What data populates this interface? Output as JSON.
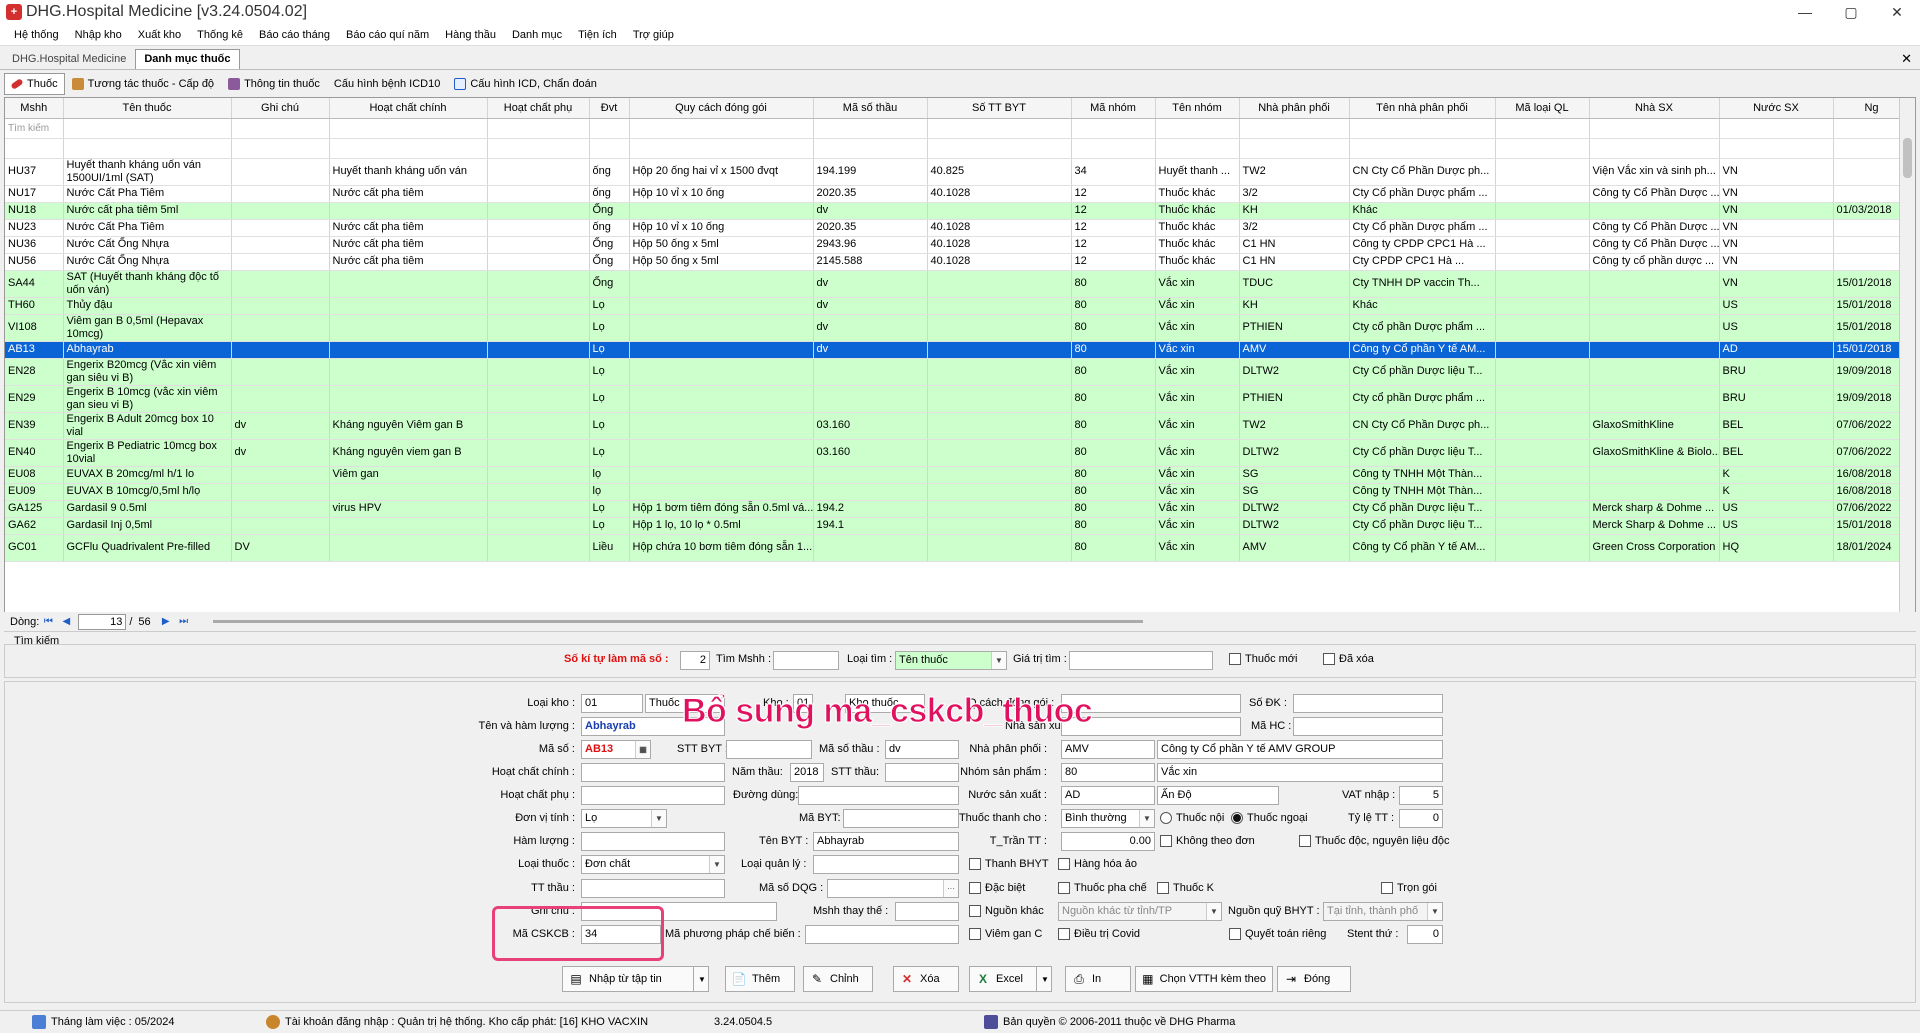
{
  "window": {
    "title": "DHG.Hospital Medicine [v3.24.0504.02]",
    "min": "—",
    "max": "▢",
    "close": "✕"
  },
  "menu": [
    "Hệ thống",
    "Nhập kho",
    "Xuất kho",
    "Thống kê",
    "Báo cáo tháng",
    "Báo cáo quí năm",
    "Hàng thầu",
    "Danh mục",
    "Tiện ích",
    "Trợ giúp"
  ],
  "doc_tabs": [
    "DHG.Hospital Medicine",
    "Danh mục thuốc"
  ],
  "sub_tabs": [
    "Thuốc",
    "Tương tác thuốc - Cấp độ",
    "Thông tin thuốc",
    "Cấu hình bệnh ICD10",
    "Cấu hình ICD, Chẩn đoán"
  ],
  "grid": {
    "columns": [
      "Mshh",
      "Tên thuốc",
      "Ghi chú",
      "Hoạt chất chính",
      "Hoạt chất phụ",
      "Đvt",
      "Quy cách đóng gói",
      "Mã số thầu",
      "Số TT BYT",
      "Mã nhóm",
      "Tên nhóm",
      "Nhà phân phối",
      "Tên nhà phân phối",
      "Mã loại QL",
      "Nhà SX",
      "Nước SX",
      "Ng"
    ],
    "filter_placeholder": "Tìm kiếm",
    "rows": [
      {
        "style": "white",
        "cells": [
          "HU37",
          "Huyết thanh kháng uốn ván 1500UI/1ml (SAT)",
          "",
          "Huyết thanh kháng uốn ván",
          "",
          "ống",
          "Hộp 20 ống hai vỉ x 1500 đvqt",
          "194.199",
          "40.825",
          "34",
          "Huyết thanh ...",
          "TW2",
          "CN Cty Cổ Phần Dược ph...",
          "",
          "Viện Vắc xin và sinh ph...",
          "VN",
          ""
        ]
      },
      {
        "style": "white",
        "cells": [
          "NU17",
          "Nước Cất Pha Tiêm",
          "",
          "Nước cất pha tiêm",
          "",
          "ống",
          "Hộp 10 vỉ x 10 ống",
          "2020.35",
          "40.1028",
          "12",
          "Thuốc khác",
          "3/2",
          "Cty Cổ phần Dược phẩm ...",
          "",
          "Công ty Cổ Phần Dược ...",
          "VN",
          ""
        ]
      },
      {
        "style": "green",
        "cells": [
          "NU18",
          "Nước cất pha tiêm 5ml",
          "",
          "",
          "",
          "Ống",
          "",
          "dv",
          "",
          "12",
          "Thuốc khác",
          "KH",
          "Khác",
          "",
          "",
          "VN",
          "01/03/2018"
        ]
      },
      {
        "style": "white",
        "cells": [
          "NU23",
          "Nước Cất Pha Tiêm",
          "",
          "Nước cất pha tiêm",
          "",
          "ống",
          "Hộp 10 vỉ x 10 ống",
          "2020.35",
          "40.1028",
          "12",
          "Thuốc khác",
          "3/2",
          "Cty Cổ phần Dược phẩm ...",
          "",
          "Công ty Cổ Phần Dược ...",
          "VN",
          ""
        ]
      },
      {
        "style": "white",
        "cells": [
          "NU36",
          "Nước Cất Ống Nhựa",
          "",
          "Nước cất pha tiêm",
          "",
          "Ống",
          "Hộp 50 ống x 5ml",
          "2943.96",
          "40.1028",
          "12",
          "Thuốc khác",
          "C1 HN",
          "Công ty CPDP CPC1 Hà ...",
          "",
          "Công ty Cổ Phần Dược ...",
          "VN",
          ""
        ]
      },
      {
        "style": "white",
        "cells": [
          "NU56",
          "Nước Cất Ống Nhựa",
          "",
          "Nước cất pha tiêm",
          "",
          "Ống",
          "Hộp 50 ống x 5ml",
          "2145.588",
          "40.1028",
          "12",
          "Thuốc khác",
          "C1 HN",
          "Cty CPDP CPC1 Hà ...",
          "",
          "Công ty cổ phần dược ...",
          "VN",
          ""
        ]
      },
      {
        "style": "green",
        "cells": [
          "SA44",
          "SAT (Huyết thanh kháng độc tố uốn ván)",
          "",
          "",
          "",
          "Ống",
          "",
          "dv",
          "",
          "80",
          "Vắc xin",
          "TDUC",
          "Cty TNHH DP vaccin Th...",
          "",
          "",
          "VN",
          "15/01/2018"
        ]
      },
      {
        "style": "green",
        "cells": [
          "TH60",
          "Thủy đậu",
          "",
          "",
          "",
          "Lọ",
          "",
          "dv",
          "",
          "80",
          "Vắc xin",
          "KH",
          "Khác",
          "",
          "",
          "US",
          "15/01/2018"
        ]
      },
      {
        "style": "green",
        "cells": [
          "VI108",
          "Viêm gan B 0,5ml (Hepavax 10mcg)",
          "",
          "",
          "",
          "Lọ",
          "",
          "dv",
          "",
          "80",
          "Vắc xin",
          "PTHIEN",
          "Cty cổ phần Dược phẩm ...",
          "",
          "",
          "US",
          "15/01/2018"
        ]
      },
      {
        "style": "selected",
        "cells": [
          "AB13",
          "Abhayrab",
          "",
          "",
          "",
          "Lọ",
          "",
          "dv",
          "",
          "80",
          "Vắc xin",
          "AMV",
          "Công ty Cổ phần Y tế AM...",
          "",
          "",
          "AD",
          "15/01/2018"
        ]
      },
      {
        "style": "green",
        "cells": [
          "EN28",
          "Engerix B20mcg (Vắc xin viêm gan siêu vi B)",
          "",
          "",
          "",
          "Lọ",
          "",
          "",
          "",
          "80",
          "Vắc xin",
          "DLTW2",
          "Cty Cổ phần Dược liệu T...",
          "",
          "",
          "BRU",
          "19/09/2018"
        ]
      },
      {
        "style": "green",
        "cells": [
          "EN29",
          "Engerix B 10mcg (vắc xin viêm gan sieu vi B)",
          "",
          "",
          "",
          "Lọ",
          "",
          "",
          "",
          "80",
          "Vắc xin",
          "PTHIEN",
          "Cty cổ phần Dược phẩm ...",
          "",
          "",
          "BRU",
          "19/09/2018"
        ]
      },
      {
        "style": "green",
        "cells": [
          "EN39",
          "Engerix B Adult 20mcg box 10 vial",
          "dv",
          "Kháng nguyên Viêm gan B",
          "",
          "Lọ",
          "",
          "03.160",
          "",
          "80",
          "Vắc xin",
          "TW2",
          "CN Cty Cổ Phần Dược ph...",
          "",
          "GlaxoSmithKline",
          "BEL",
          "07/06/2022"
        ]
      },
      {
        "style": "green",
        "cells": [
          "EN40",
          "Engerix B Pediatric 10mcg box 10vial",
          "dv",
          "Kháng nguyên viem gan B",
          "",
          "Lọ",
          "",
          "03.160",
          "",
          "80",
          "Vắc xin",
          "DLTW2",
          "Cty Cổ phần Dược liệu T...",
          "",
          "GlaxoSmithKline & Biolo...",
          "BEL",
          "07/06/2022"
        ]
      },
      {
        "style": "green",
        "cells": [
          "EU08",
          "EUVAX B 20mcg/ml  h/1 lo",
          "",
          "Viêm gan",
          "",
          "lọ",
          "",
          "",
          "",
          "80",
          "Vắc xin",
          "SG",
          "Công ty TNHH Một Thàn...",
          "",
          "",
          "K",
          "16/08/2018"
        ]
      },
      {
        "style": "green",
        "cells": [
          "EU09",
          "EUVAX B 10mcg/0,5ml  h/lọ",
          "",
          "",
          "",
          "lọ",
          "",
          "",
          "",
          "80",
          "Vắc xin",
          "SG",
          "Công ty TNHH Một Thàn...",
          "",
          "",
          "K",
          "16/08/2018"
        ]
      },
      {
        "style": "green",
        "cells": [
          "GA125",
          "Gardasil 9 0.5ml",
          "",
          "virus HPV",
          "",
          "Lọ",
          "Hộp 1 bơm tiêm đóng sẵn 0.5ml vá...",
          "194.2",
          "",
          "80",
          "Vắc xin",
          "DLTW2",
          "Cty Cổ phần Dược liệu T...",
          "",
          "Merck sharp & Dohme ...",
          "US",
          "07/06/2022"
        ]
      },
      {
        "style": "green",
        "cells": [
          "GA62",
          "Gardasil Inj 0,5ml",
          "",
          "",
          "",
          "Lọ",
          "Hộp 1 lọ, 10 lọ * 0.5ml",
          "194.1",
          "",
          "80",
          "Vắc xin",
          "DLTW2",
          "Cty Cổ phần Dược liệu T...",
          "",
          "Merck Sharp & Dohme ...",
          "US",
          "15/01/2018"
        ]
      },
      {
        "style": "green",
        "cells": [
          "GC01",
          "GCFlu Quadrivalent Pre-filled",
          "DV",
          "",
          "",
          "Liều",
          "Hộp chứa 10 bơm tiêm đóng sẵn 1...",
          "",
          "",
          "80",
          "Vắc xin",
          "AMV",
          "Công ty Cổ phần Y tế AM...",
          "",
          "Green Cross Corporation",
          "HQ",
          "18/01/2024"
        ]
      }
    ]
  },
  "pager": {
    "label": "Dòng:",
    "current": "13",
    "sep": "/",
    "total": "56"
  },
  "search": {
    "title": "Tìm kiếm",
    "so_ki_tu_label": "Số kí tự làm mã số :",
    "so_ki_tu_value": "2",
    "tim_mshh_label": "Tìm Mshh :",
    "tim_mshh_value": "",
    "loai_tim_label": "Loại tìm :",
    "loai_tim_value": "Tên thuốc",
    "gia_tri_label": "Giá trị tìm :",
    "gia_tri_value": "",
    "thuoc_moi": "Thuốc mới",
    "da_xoa": "Đã xóa"
  },
  "overlay_note": "Bổ sung ma_cskcb_thuoc",
  "detail": {
    "loai_kho_label": "Loại kho :",
    "loai_kho_code": "01",
    "loai_kho_name": "Thuốc",
    "kho_label": "Kho :",
    "kho_code": "01",
    "kho_name": "Kho thuốc",
    "qcach_label": "Q.cách đóng gói :",
    "qcach_value": "",
    "so_dk_label": "Số ĐK :",
    "so_dk_value": "",
    "ten_hl_label": "Tên và hàm lượng :",
    "ten_hl_value": "Abhayrab",
    "nha_sx_label": "Nhà sản xuất :",
    "nha_sx_value": "",
    "ma_hc_label": "Mã HC :",
    "ma_hc_value": "",
    "ma_so_label": "Mã số :",
    "ma_so_value": "AB13",
    "stt_byt_label": "STT BYT :",
    "stt_byt_value": "",
    "ma_so_thau_label": "Mã số thầu :",
    "ma_so_thau_value": "dv",
    "nha_pp_label": "Nhà phân phối :",
    "nha_pp_code": "AMV",
    "nha_pp_name": "Công ty Cổ phần Y tế AMV GROUP",
    "hc_chinh_label": "Hoạt chất chính :",
    "hc_chinh_value": "",
    "nam_thau_label": "Năm thầu:",
    "nam_thau_value": "2018",
    "stt_thau_label": "STT thầu:",
    "stt_thau_value": "",
    "nhom_sp_label": "Nhóm sản phẩm :",
    "nhom_sp_code": "80",
    "nhom_sp_name": "Vắc xin",
    "hc_phu_label": "Hoạt chất phụ :",
    "hc_phu_value": "",
    "duong_dung_label": "Đường dùng:",
    "duong_dung_value": "",
    "nuoc_sx_label": "Nước sản xuất :",
    "nuoc_sx_code": "AD",
    "nuoc_sx_name": "Ấn Độ",
    "vat_label": "VAT nhập :",
    "vat_value": "5",
    "dvt_label": "Đơn vị tính :",
    "dvt_value": "Lọ",
    "ma_byt_label": "Mã BYT:",
    "ma_byt_value": "",
    "thanh_toan_label": "Thuốc thanh cho :",
    "thanh_toan_value": "Bình thường",
    "thuoc_noi": "Thuốc nội",
    "thuoc_ngoai": "Thuốc ngoại",
    "ty_le_label": "Tỷ lệ TT :",
    "ty_le_value": "0",
    "ham_luong_label": "Hàm lượng :",
    "ham_luong_value": "",
    "ten_byt_label": "Tên BYT :",
    "ten_byt_value": "Abhayrab",
    "tran_tt_label": "T_Trần TT :",
    "tran_tt_value": "0.00",
    "khong_theo_don": "Không theo đơn",
    "thuoc_doc": "Thuốc độc, nguyên liệu độc",
    "loai_thuoc_label": "Loại thuốc :",
    "loai_thuoc_value": "Đơn chất",
    "loai_ql_label": "Loại quản lý :",
    "loai_ql_value": "",
    "thanh_bhyt": "Thanh BHYT",
    "hang_hoa_ao": "Hàng hóa ảo",
    "tt_thau_label": "TT thầu :",
    "tt_thau_value": "",
    "ma_dqg_label": "Mã số DQG :",
    "ma_dqg_value": "",
    "dac_biet": "Đặc biệt",
    "thuoc_pha_che": "Thuốc pha chế",
    "thuoc_k": "Thuốc K",
    "tron_goi": "Trọn gói",
    "ghi_chu_label": "Ghi chú :",
    "ghi_chu_value": "",
    "mshh_thay_the_label": "Mshh thay thế :",
    "mshh_thay_the_value": "",
    "nguon_khac": "Nguồn khác",
    "nguon_khac_value": "Nguồn khác từ tỉnh/TP",
    "nguon_quy_label": "Nguồn quỹ BHYT :",
    "nguon_quy_value": "Tại tỉnh, thành phố",
    "ma_cskcb_label": "Mã CSKCB :",
    "ma_cskcb_value": "34",
    "ma_ppcb_label": "Mã phương pháp chế biến :",
    "ma_ppcb_value": "",
    "viem_gan_c": "Viêm gan C",
    "dieu_tri_covid": "Điều trị Covid",
    "quyet_toan_rieng": "Quyết toán riêng",
    "stent_label": "Stent thứ :",
    "stent_value": "0"
  },
  "buttons": {
    "nhap": "Nhập từ tập tin",
    "them": "Thêm",
    "chinh": "Chỉnh",
    "xoa": "Xóa",
    "excel": "Excel",
    "in": "In",
    "chon_vtth": "Chọn VTTH kèm theo",
    "dong": "Đóng"
  },
  "status": {
    "thang": "Tháng làm việc : 05/2024",
    "tai_khoan": "Tài khoản đăng nhập : Quản trị hệ thống. Kho cấp phát: [16] KHO VACXIN",
    "version": "3.24.0504.5",
    "copyright": "Bản quyền © 2006-2011 thuộc về DHG Pharma"
  },
  "colors": {
    "row_green": "#ccffcc",
    "row_selected": "#0a64d6",
    "highlight": "#e8417a",
    "overlay_text": "#e0115f"
  }
}
